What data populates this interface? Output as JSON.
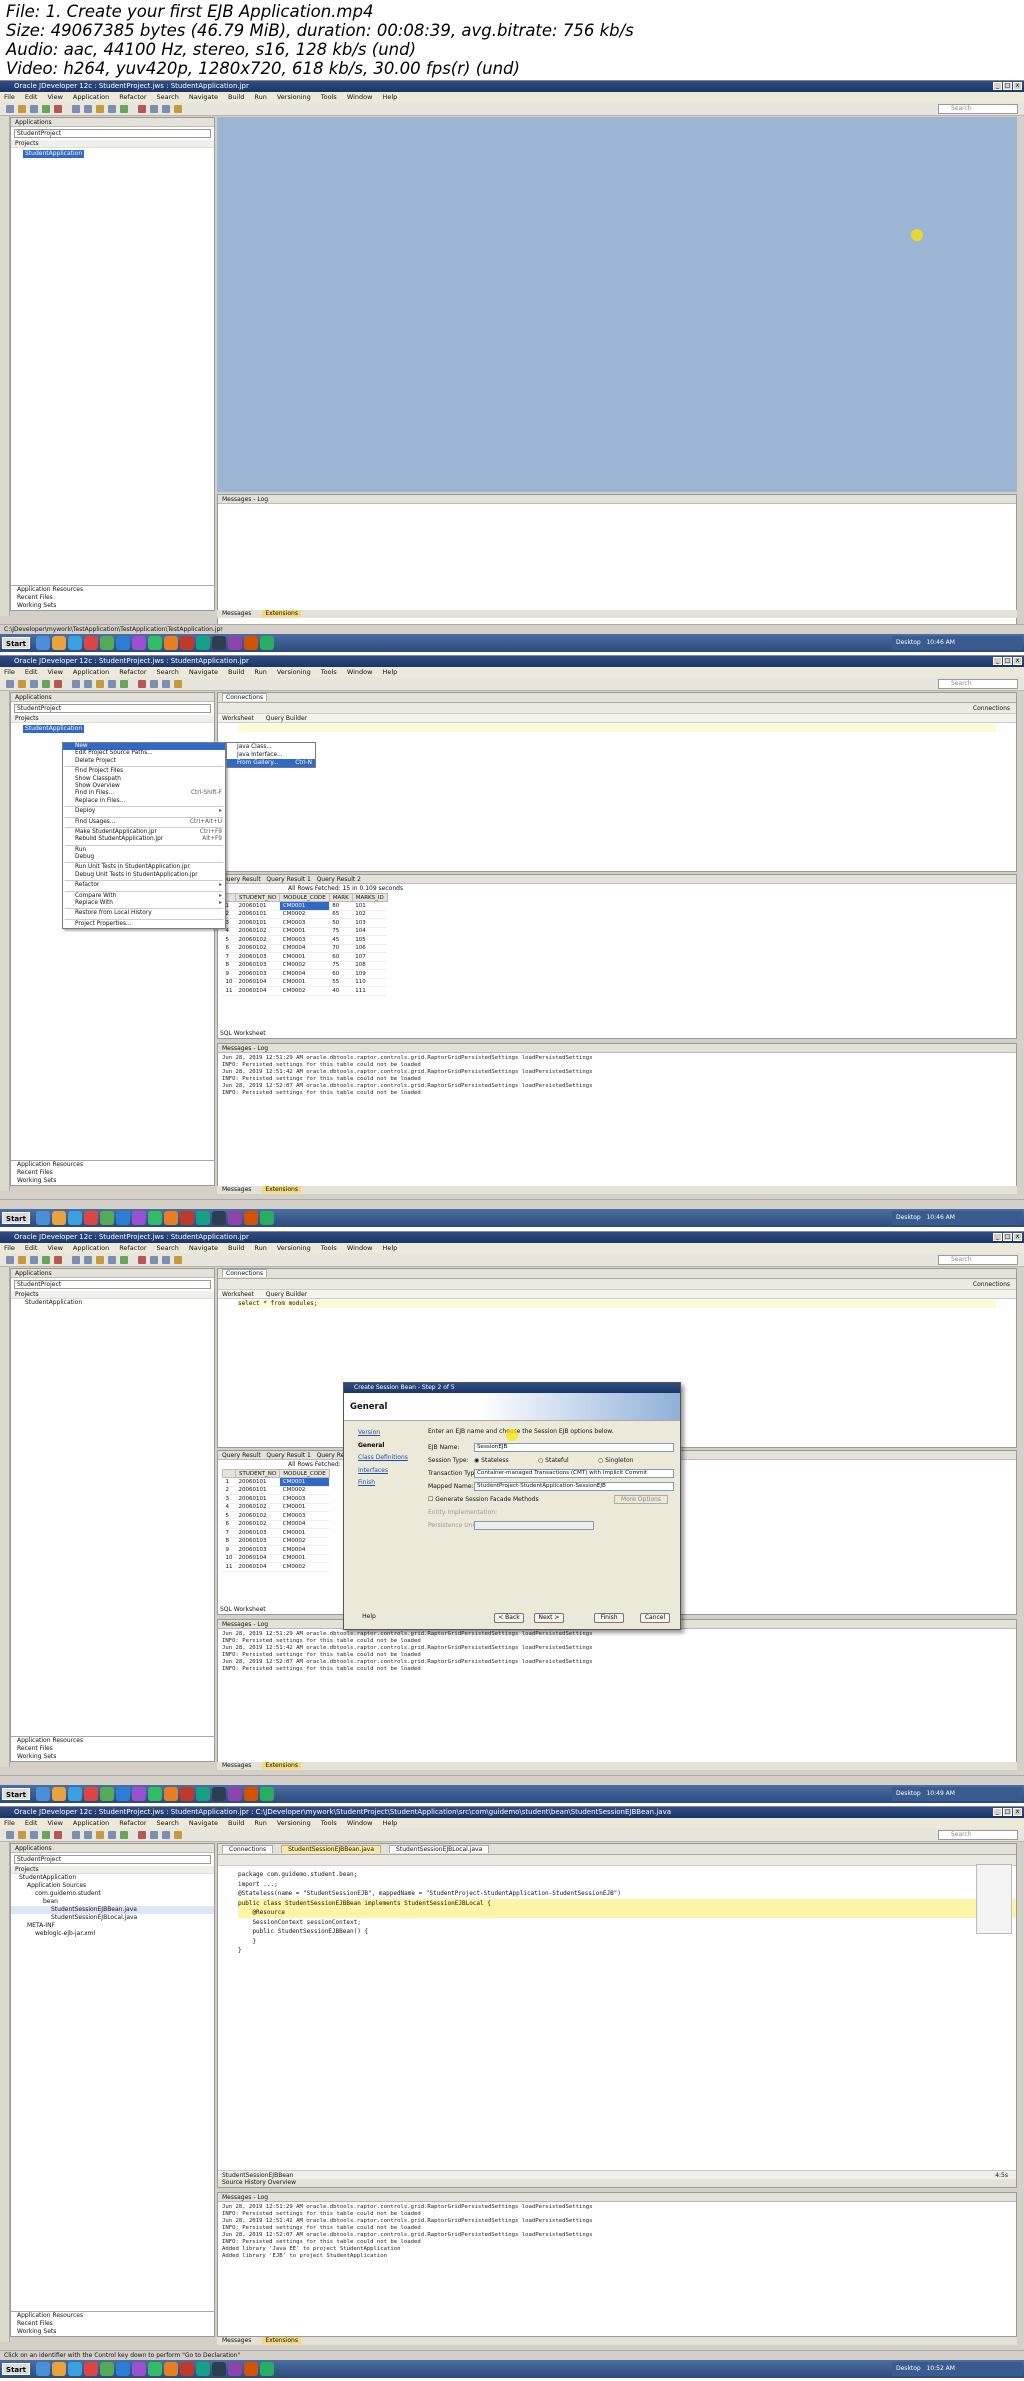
{
  "info": {
    "file": "File: 1. Create your first EJB Application.mp4",
    "size": "Size: 49067385 bytes (46.79 MiB), duration: 00:08:39, avg.bitrate: 756 kb/s",
    "audio": "Audio: aac, 44100 Hz, stereo, s16, 128 kb/s (und)",
    "video": "Video: h264, yuv420p, 1280x720, 618 kb/s, 30.00 fps(r) (und)"
  },
  "menu": [
    "File",
    "Edit",
    "View",
    "Application",
    "Refactor",
    "Search",
    "Navigate",
    "Build",
    "Run",
    "Versioning",
    "Tools",
    "Window",
    "Help"
  ],
  "search_placeholder": "Search",
  "panel": {
    "applications": "Applications",
    "project_combo": "StudentProject",
    "projects": "Projects",
    "application_resources": "Application Resources",
    "recent_files": "Recent Files",
    "working_sets": "Working Sets",
    "messages_log": "Messages - Log",
    "messages_tab": "Messages",
    "extensions_tab": "Extensions",
    "desktop": "Desktop"
  },
  "frames": [
    {
      "title": "Oracle JDeveloper 12c : StudentProject.jws : StudentApplication.jpr",
      "tree_item": "StudentApplication",
      "status": "C:\\JDeveloper\\mywork\\TestApplication\\TestApplication\\TestApplication.jpr",
      "time": "10:46 AM"
    },
    {
      "title": "Oracle JDeveloper 12c : StudentProject.jws : StudentApplication.jpr",
      "tree_item": "StudentApplication",
      "connections_tab": "Connections",
      "connections_right": "Connections",
      "worksheet_tab": "Worksheet",
      "query_builder_tab": "Query Builder",
      "result_tabs": [
        "Query Result",
        "Query Result 1",
        "Query Result 2"
      ],
      "fetch_info": "All Rows Fetched: 15 in 0.109 seconds",
      "columns": [
        "STUDENT_NO",
        "MODULE_CODE",
        "MARK",
        "MARKS_ID"
      ],
      "rows": [
        [
          "1",
          "20060101",
          "CM0001",
          "80",
          "101"
        ],
        [
          "2",
          "20060101",
          "CM0002",
          "65",
          "102"
        ],
        [
          "3",
          "20060101",
          "CM0003",
          "50",
          "103"
        ],
        [
          "4",
          "20060102",
          "CM0001",
          "75",
          "104"
        ],
        [
          "5",
          "20060102",
          "CM0003",
          "45",
          "105"
        ],
        [
          "6",
          "20060102",
          "CM0004",
          "70",
          "106"
        ],
        [
          "7",
          "20060103",
          "CM0001",
          "60",
          "107"
        ],
        [
          "8",
          "20060103",
          "CM0002",
          "75",
          "108"
        ],
        [
          "9",
          "20060103",
          "CM0004",
          "60",
          "109"
        ],
        [
          "10",
          "20060104",
          "CM0001",
          "55",
          "110"
        ],
        [
          "11",
          "20060104",
          "CM0002",
          "40",
          "111"
        ]
      ],
      "sql_worksheet": "SQL Worksheet",
      "context_menu": [
        {
          "label": "New",
          "shortcut": "",
          "hl": true
        },
        {
          "label": "Edit Project Source Paths...",
          "shortcut": ""
        },
        {
          "label": "Delete Project",
          "shortcut": ""
        },
        {
          "sep": true
        },
        {
          "label": "Find Project Files",
          "shortcut": ""
        },
        {
          "label": "Show Classpath",
          "shortcut": ""
        },
        {
          "label": "Show Overview",
          "shortcut": ""
        },
        {
          "label": "Find in Files...",
          "shortcut": "Ctrl-Shift-F"
        },
        {
          "label": "Replace in Files...",
          "shortcut": ""
        },
        {
          "sep": true
        },
        {
          "label": "Deploy",
          "shortcut": "▸"
        },
        {
          "sep": true
        },
        {
          "label": "Find Usages...",
          "shortcut": "Ctrl+Alt+U"
        },
        {
          "sep": true
        },
        {
          "label": "Make StudentApplication.jpr",
          "shortcut": "Ctrl+F9"
        },
        {
          "label": "Rebuild StudentApplication.jpr",
          "shortcut": "Alt+F9"
        },
        {
          "sep": true
        },
        {
          "label": "Run",
          "shortcut": ""
        },
        {
          "label": "Debug",
          "shortcut": ""
        },
        {
          "sep": true
        },
        {
          "label": "Run Unit Tests in StudentApplication.jpr",
          "shortcut": ""
        },
        {
          "label": "Debug Unit Tests in StudentApplication.jpr",
          "shortcut": ""
        },
        {
          "sep": true
        },
        {
          "label": "Refactor",
          "shortcut": "▸"
        },
        {
          "sep": true
        },
        {
          "label": "Compare With",
          "shortcut": "▸"
        },
        {
          "label": "Replace With",
          "shortcut": "▸"
        },
        {
          "sep": true
        },
        {
          "label": "Restore from Local History",
          "shortcut": ""
        },
        {
          "sep": true
        },
        {
          "label": "Project Properties...",
          "shortcut": ""
        }
      ],
      "submenu": [
        {
          "label": "Java Class...",
          "hl": false
        },
        {
          "label": "Java Interface...",
          "hl": false
        },
        {
          "label": "From Gallery...",
          "shortcut": "Ctrl-N",
          "hl": true
        }
      ],
      "log": [
        "Jun 28, 2019 12:51:29 AM oracle.dbtools.raptor.controls.grid.RaptorGridPersistedSettings loadPersistedSettings",
        "INFO: Persisted settings for this table could not be loaded",
        "Jun 28, 2019 12:51:42 AM oracle.dbtools.raptor.controls.grid.RaptorGridPersistedSettings loadPersistedSettings",
        "INFO: Persisted settings for this table could not be loaded",
        "Jun 28, 2019 12:52:07 AM oracle.dbtools.raptor.controls.grid.RaptorGridPersistedSettings loadPersistedSettings",
        "INFO: Persisted settings for this table could not be loaded"
      ],
      "time": "10:46 AM"
    },
    {
      "title": "Oracle JDeveloper 12c : StudentProject.jws : StudentApplication.jpr",
      "tree_item": "StudentApplication",
      "connections_tab": "Connections",
      "connections_right": "Connections",
      "worksheet_tab": "Worksheet",
      "query_builder_tab": "Query Builder",
      "sql": "select * from modules;",
      "result_tabs": [
        "Query Result",
        "Query Result 1",
        "Query Result 2"
      ],
      "fetch_info": "All Rows Fetched: 15",
      "columns": [
        "STUDENT_NO",
        "MODULE_CODE"
      ],
      "rows": [
        [
          "1",
          "20060101",
          "CM0001"
        ],
        [
          "2",
          "20060101",
          "CM0002"
        ],
        [
          "3",
          "20060101",
          "CM0003"
        ],
        [
          "4",
          "20060102",
          "CM0001"
        ],
        [
          "5",
          "20060102",
          "CM0003"
        ],
        [
          "6",
          "20060102",
          "CM0004"
        ],
        [
          "7",
          "20060103",
          "CM0001"
        ],
        [
          "8",
          "20060103",
          "CM0002"
        ],
        [
          "9",
          "20060103",
          "CM0004"
        ],
        [
          "10",
          "20060104",
          "CM0001"
        ],
        [
          "11",
          "20060104",
          "CM0002"
        ]
      ],
      "sql_worksheet": "SQL Worksheet",
      "dialog": {
        "title": "Create Session Bean - Step 2 of 5",
        "banner": "General",
        "nav": [
          "Version",
          "General",
          "Class Definitions",
          "Interfaces",
          "Finish"
        ],
        "intro": "Enter an EJB name and choose the Session EJB options below.",
        "ejb_name_label": "EJB Name:",
        "ejb_name_value": "SessionEJB",
        "session_type_label": "Session Type:",
        "session_types": [
          "Stateless",
          "Stateful",
          "Singleton"
        ],
        "transaction_label": "Transaction Type:",
        "transaction_value": "Container-managed Transactions (CMT) with Implicit Commit",
        "mapped_label": "Mapped Name:",
        "mapped_value": "StudentProject-StudentApplication-SessionEJB",
        "facade_label": "Generate Session Facade Methods",
        "entity_label": "Entity Implementation:",
        "persistence_label": "Persistence Unit:",
        "buttons": [
          "Help",
          "< Back",
          "Next >",
          "Finish",
          "Cancel"
        ],
        "more_options": "More Options"
      },
      "log": [
        "Jun 28, 2019 12:51:29 AM oracle.dbtools.raptor.controls.grid.RaptorGridPersistedSettings loadPersistedSettings",
        "INFO: Persisted settings for this table could not be loaded",
        "Jun 28, 2019 12:51:42 AM oracle.dbtools.raptor.controls.grid.RaptorGridPersistedSettings loadPersistedSettings",
        "INFO: Persisted settings for this table could not be loaded",
        "Jun 28, 2019 12:52:07 AM oracle.dbtools.raptor.controls.grid.RaptorGridPersistedSettings loadPersistedSettings",
        "INFO: Persisted settings for this table could not be loaded"
      ],
      "time": "10:49 AM"
    },
    {
      "title": "Oracle JDeveloper 12c : StudentProject.jws : StudentApplication.jpr : C:\\JDeveloper\\mywork\\StudentProject\\StudentApplication\\src\\com\\guidemo\\student\\bean\\StudentSessionEJBBean.java",
      "tree": [
        {
          "label": "StudentApplication",
          "indent": 0
        },
        {
          "label": "Application Sources",
          "indent": 1
        },
        {
          "label": "com.guidemo.student",
          "indent": 2
        },
        {
          "label": "bean",
          "indent": 3
        },
        {
          "label": "StudentSessionEJBBean.java",
          "indent": 4
        },
        {
          "label": "StudentSessionEJBLocal.java",
          "indent": 4
        },
        {
          "label": "META-INF",
          "indent": 1
        },
        {
          "label": "weblogic-ejb-jar.xml",
          "indent": 2
        }
      ],
      "tabs": [
        "Connections",
        "StudentSessionEJBBean.java",
        "StudentSessionEJBLocal.java"
      ],
      "code": [
        "package com.guidemo.student.bean;",
        "",
        "import ...;",
        "",
        "@Stateless(name = \"StudentSessionEJB\", mappedName = \"StudentProject-StudentApplication-StudentSessionEJB\")",
        "public class StudentSessionEJBBean implements StudentSessionEJBLocal {",
        "    @Resource",
        "    SessionContext sessionContext;",
        "",
        "    public StudentSessionEJBBean() {",
        "    }",
        "}"
      ],
      "editor_footer": "StudentSessionEJBBean",
      "editor_subtabs": "Source  History  Overview",
      "position": "4:5s",
      "log": [
        "Jun 28, 2019 12:51:29 AM oracle.dbtools.raptor.controls.grid.RaptorGridPersistedSettings loadPersistedSettings",
        "INFO: Persisted settings for this table could not be loaded",
        "Jun 28, 2019 12:51:42 AM oracle.dbtools.raptor.controls.grid.RaptorGridPersistedSettings loadPersistedSettings",
        "INFO: Persisted settings for this table could not be loaded",
        "Jun 28, 2019 12:52:07 AM oracle.dbtools.raptor.controls.grid.RaptorGridPersistedSettings loadPersistedSettings",
        "INFO: Persisted settings for this table could not be loaded",
        "Added library 'Java EE' to project StudentApplication",
        "Added library 'EJB' to project StudentApplication"
      ],
      "status": "Click on an identifier with the Control key down to perform \"Go to Declaration\"",
      "time": "10:52 AM"
    }
  ]
}
